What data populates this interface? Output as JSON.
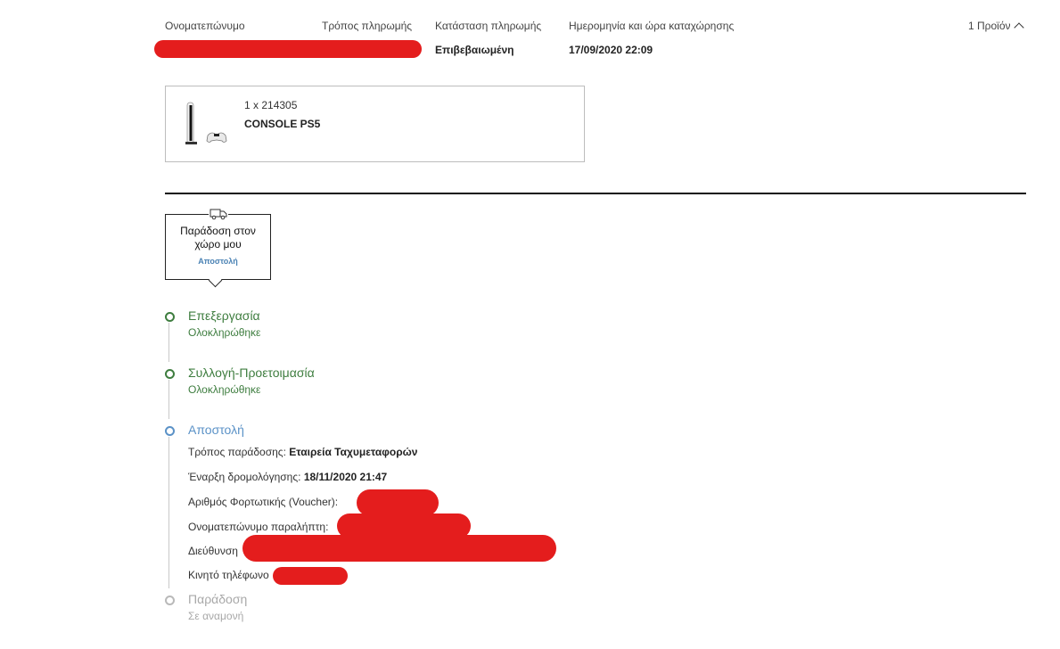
{
  "header": {
    "name_label": "Ονοματεπώνυμο",
    "payment_method_label": "Τρόπος πληρωμής",
    "payment_status_label": "Κατάσταση πληρωμής",
    "date_label": "Ημερομηνία και ώρα καταχώρησης",
    "products_toggle": "1 Προϊόν",
    "payment_status_value": "Επιβεβαιωμένη",
    "date_value": "17/09/2020 22:09"
  },
  "product": {
    "quantity_code": "1 x 214305",
    "name": "CONSOLE PS5"
  },
  "delivery": {
    "title": "Παράδοση στον χώρο μου",
    "status": "Αποστολή"
  },
  "steps": [
    {
      "title": "Επεξεργασία",
      "subtitle": "Ολοκληρώθηκε"
    },
    {
      "title": "Συλλογή-Προετοιμασία",
      "subtitle": "Ολοκληρώθηκε"
    },
    {
      "title": "Αποστολή"
    },
    {
      "title": "Παράδοση",
      "subtitle": "Σε αναμονή"
    }
  ],
  "shipment": {
    "delivery_method_label": "Τρόπος παράδοσης:",
    "delivery_method_value": "Εταιρεία Ταχυμεταφορών",
    "routing_start_label": "Έναρξη δρομολόγησης:",
    "routing_start_value": "18/11/2020 21:47",
    "voucher_label": "Αριθμός Φορτωτικής (Voucher):",
    "recipient_label": "Ονοματεπώνυμο παραλήπτη:",
    "address_label": "Διεύθυνση",
    "mobile_label": "Κινητό τηλέφωνο"
  },
  "colors": {
    "completed": "#3e7d3f",
    "active": "#5b92c7",
    "pending": "#a8a8a8",
    "redaction": "#e41d1d"
  }
}
